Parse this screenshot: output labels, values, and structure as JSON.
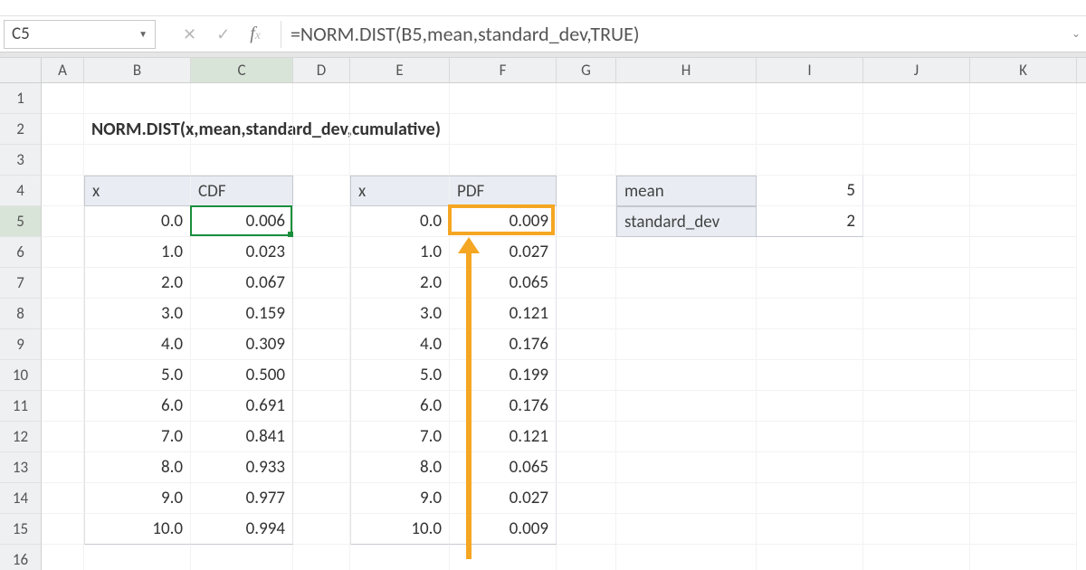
{
  "namebox": {
    "value": "C5"
  },
  "formula_bar": {
    "formula": "=NORM.DIST(B5,mean,standard_dev,TRUE)"
  },
  "columns": [
    "A",
    "B",
    "C",
    "D",
    "E",
    "F",
    "G",
    "H",
    "I",
    "J",
    "K"
  ],
  "visible_rows": [
    1,
    2,
    3,
    4,
    5,
    6,
    7,
    8,
    9,
    10,
    11,
    12,
    13,
    14,
    15,
    16
  ],
  "title": "NORM.DIST(x,mean,standard_dev,cumulative)",
  "headers": {
    "x1": "x",
    "cdf": "CDF",
    "x2": "x",
    "pdf": "PDF",
    "mean_label": "mean",
    "sd_label": "standard_dev"
  },
  "params": {
    "mean": "5",
    "standard_dev": "2"
  },
  "table": {
    "x": [
      "0.0",
      "1.0",
      "2.0",
      "3.0",
      "4.0",
      "5.0",
      "6.0",
      "7.0",
      "8.0",
      "9.0",
      "10.0"
    ],
    "cdf": [
      "0.006",
      "0.023",
      "0.067",
      "0.159",
      "0.309",
      "0.500",
      "0.691",
      "0.841",
      "0.933",
      "0.977",
      "0.994"
    ],
    "pdf": [
      "0.009",
      "0.027",
      "0.065",
      "0.121",
      "0.176",
      "0.199",
      "0.176",
      "0.121",
      "0.065",
      "0.027",
      "0.009"
    ]
  },
  "active_cell": "C5",
  "highlighted_cell": "F5"
}
